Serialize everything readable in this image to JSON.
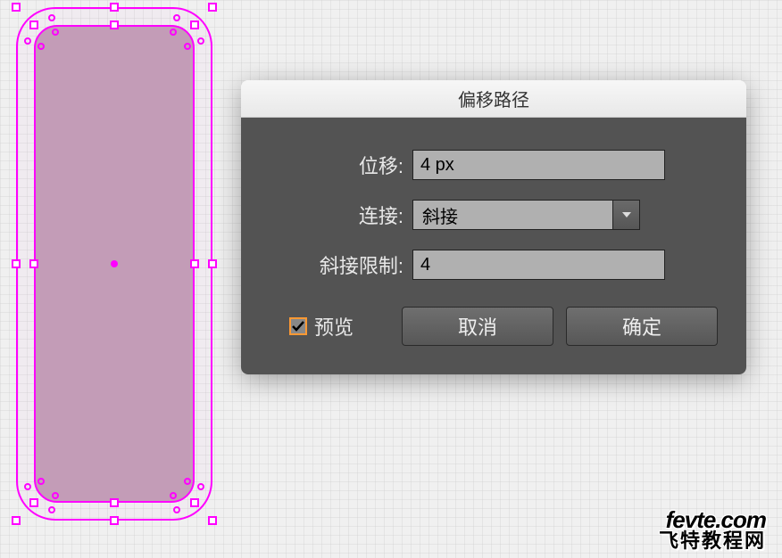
{
  "dialog": {
    "title": "偏移路径",
    "fields": {
      "offset": {
        "label": "位移:",
        "value": "4 px"
      },
      "join": {
        "label": "连接:",
        "value": "斜接"
      },
      "miterLimit": {
        "label": "斜接限制:",
        "value": "4"
      }
    },
    "preview": {
      "checked": true,
      "label": "预览"
    },
    "buttons": {
      "cancel": "取消",
      "ok": "确定"
    }
  },
  "watermark": {
    "line1": "fevte.com",
    "line2": "飞特教程网"
  }
}
